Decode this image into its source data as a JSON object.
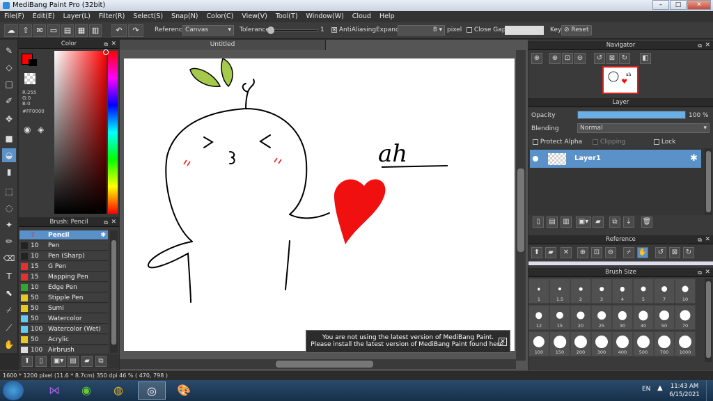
{
  "window": {
    "title": "MediBang Paint Pro (32bit)",
    "min": "–",
    "max": "□",
    "close": "✕"
  },
  "menu": [
    "File(F)",
    "Edit(E)",
    "Layer(L)",
    "Filter(R)",
    "Select(S)",
    "Snap(N)",
    "Color(C)",
    "View(V)",
    "Tool(T)",
    "Window(W)",
    "Cloud",
    "Help"
  ],
  "toolbar": {
    "reference_label": "Reference",
    "reference_value": "Canvas",
    "tolerance_label": "Tolerance",
    "tolerance_value": "1",
    "antialiasing_label": "AntiAliasing",
    "expand_label": "Expand",
    "expand_value": "8",
    "expand_unit": "pixel",
    "close_gaps_label": "Close Gaps",
    "key_label": "Key",
    "reset_label": "Reset"
  },
  "color_panel": {
    "title": "Color",
    "r": "R:255",
    "g": "G:0",
    "b": "B:0",
    "hex": "#FF0000",
    "primary_color": "#ff0000"
  },
  "document": {
    "tab": "Untitled",
    "handwriting": "ah"
  },
  "brush_panel": {
    "title": "Brush: Pencil",
    "items": [
      {
        "size": "7",
        "name": "Pencil",
        "color": "#5a91c8"
      },
      {
        "size": "10",
        "name": "Pen",
        "color": "#222222"
      },
      {
        "size": "10",
        "name": "Pen (Sharp)",
        "color": "#222222"
      },
      {
        "size": "15",
        "name": "G Pen",
        "color": "#e53030"
      },
      {
        "size": "15",
        "name": "Mapping Pen",
        "color": "#e53030"
      },
      {
        "size": "10",
        "name": "Edge Pen",
        "color": "#2ea82e"
      },
      {
        "size": "50",
        "name": "Stipple Pen",
        "color": "#e8c820"
      },
      {
        "size": "50",
        "name": "Sumi",
        "color": "#e8c820"
      },
      {
        "size": "50",
        "name": "Watercolor",
        "color": "#66c8f0"
      },
      {
        "size": "100",
        "name": "Watercolor (Wet)",
        "color": "#66c8f0"
      },
      {
        "size": "50",
        "name": "Acrylic",
        "color": "#e8c820"
      },
      {
        "size": "100",
        "name": "Airbrush",
        "color": "#dddddd"
      }
    ]
  },
  "navigator": {
    "title": "Navigator",
    "handwriting": "ah"
  },
  "layer_panel": {
    "title": "Layer",
    "opacity_label": "Opacity",
    "opacity_value": "100 %",
    "opacity_level": 1.0,
    "blending_label": "Blending",
    "blending_value": "Normal",
    "protect_alpha": "Protect Alpha",
    "clipping": "Clipping",
    "lock": "Lock",
    "layer_name": "Layer1"
  },
  "reference_panel": {
    "title": "Reference"
  },
  "brush_size_panel": {
    "title": "Brush Size",
    "sizes": [
      "1",
      "1.5",
      "2",
      "3",
      "4",
      "5",
      "7",
      "10",
      "12",
      "15",
      "20",
      "25",
      "30",
      "40",
      "50",
      "70",
      "100",
      "150",
      "200",
      "300",
      "400",
      "500",
      "700",
      "1000"
    ]
  },
  "notice": {
    "line1": "You are not using the latest version of MediBang Paint.",
    "line2": "Please install the latest version of MediBang Paint found here."
  },
  "status": {
    "text": "1600 * 1200 pixel  (11.6 * 8.7cm)  350 dpi  46 %  ( 470, 798 )"
  },
  "taskbar": {
    "lang": "EN",
    "time": "11:43 AM",
    "date": "6/15/2021"
  }
}
